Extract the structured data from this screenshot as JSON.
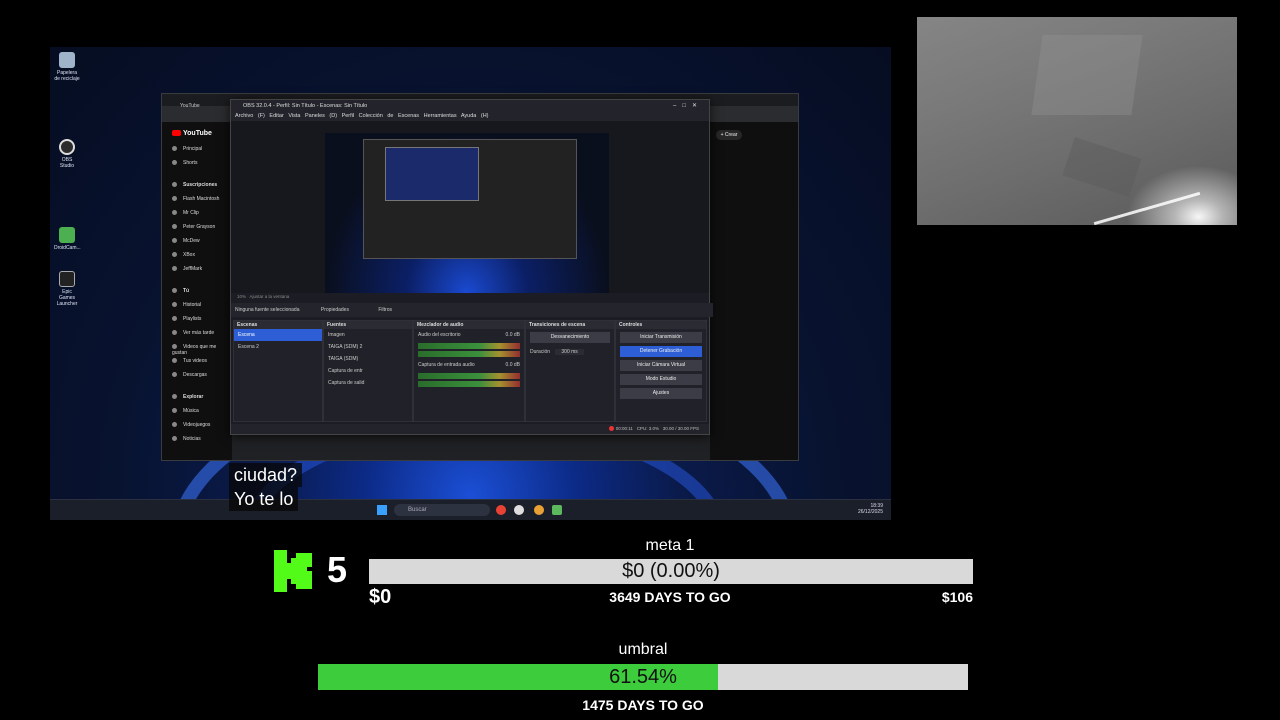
{
  "desktop": {
    "icons": [
      {
        "name": "recycle-bin",
        "label": "Papelera de reciclaje"
      },
      {
        "name": "obs-studio",
        "label": "OBS Studio"
      },
      {
        "name": "droidcam",
        "label": "DroidCam..."
      },
      {
        "name": "epic-games",
        "label": "Epic Games Launcher"
      }
    ],
    "taskbar": {
      "search_placeholder": "Buscar",
      "time": "18:39",
      "date": "26/12/2025"
    }
  },
  "chrome": {
    "tab_label": "YouTube",
    "youtube_logo": "YouTube",
    "create_label": "+ Crear",
    "sidebar": [
      "Principal",
      "Shorts",
      "Suscripciones",
      "Flash Macintosh",
      "Mr Clip",
      "Peter Grayson",
      "McDew",
      "XBox",
      "JeffMark",
      "Tú",
      "Historial",
      "Playlists",
      "Ver más tarde",
      "Videos que me gustan",
      "Tus videos",
      "Descargas",
      "Explorar",
      "Música",
      "Videojuegos",
      "Noticias"
    ]
  },
  "obs": {
    "title": "OBS 32.0.4 - Perfil: Sin Título - Escenas: Sin Título",
    "menu": [
      "Archivo (F)",
      "Editar",
      "Vista",
      "Paneles (D)",
      "Perfil",
      "Colección de Escenas",
      "Herramientas",
      "Ayuda (H)"
    ],
    "zoom": "10%",
    "zoom_fit": "Ajustar a la ventana",
    "no_source": "Ninguna fuente seleccionada",
    "properties": "Propiedades",
    "filters": "Filtros",
    "docks": {
      "scenes": {
        "title": "Escenas",
        "items": [
          "Escena",
          "Escena 2"
        ]
      },
      "sources": {
        "title": "Fuentes",
        "items": [
          "Imagen",
          "TAIGA (SDM) 2",
          "TAIGA (SDM)",
          "Captura de entr",
          "Captura de salid"
        ]
      },
      "mixer": {
        "title": "Mezclador de audio",
        "channels": [
          {
            "name": "Audio del escritorio",
            "level": "0.0 dB"
          },
          {
            "name": "Captura de entrada audio",
            "level": "0.0 dB"
          }
        ]
      },
      "transitions": {
        "title": "Transiciones de escena",
        "type": "Desvanecimiento",
        "duration_label": "Duración",
        "duration": "300 ms"
      },
      "controls": {
        "title": "Controles",
        "buttons": [
          "Iniciar Transmisión",
          "Detener Grabación",
          "Iniciar Cámara Virtual",
          "Modo Estudio",
          "Ajustes"
        ]
      }
    },
    "status": {
      "rec_time": "00:00:11",
      "cpu": "CPU: 3.0%",
      "fps": "30.00 / 30.00 FPS"
    }
  },
  "subtitles": [
    "ciudad?",
    "Yo te lo"
  ],
  "kick": {
    "count": "5",
    "brand_color": "#53fc18"
  },
  "goal1": {
    "title": "meta 1",
    "bar_text": "$0 (0.00%)",
    "progress": 0.0,
    "start": "$0",
    "days": "3649 DAYS TO GO",
    "target": "$106"
  },
  "goal2": {
    "title": "umbral",
    "bar_text": "61.54%",
    "progress": 0.6154,
    "days": "1475 DAYS TO GO",
    "fill_color": "#3ccc3c"
  }
}
